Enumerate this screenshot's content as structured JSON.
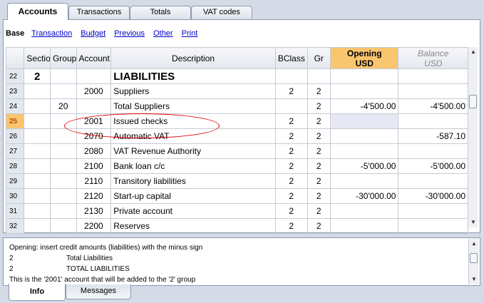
{
  "tabs": [
    "Accounts",
    "Transactions",
    "Totals",
    "VAT codes"
  ],
  "views": {
    "base": "Base",
    "links": [
      "Transaction",
      "Budget",
      "Previous",
      "Other",
      "Print"
    ]
  },
  "columns": {
    "section": "Section",
    "group": "Group",
    "account": "Account",
    "description": "Description",
    "bclass": "BClass",
    "gr": "Gr",
    "opening_line1": "Opening",
    "opening_line2": "USD",
    "balance_line1": "Balance",
    "balance_line2": "USD"
  },
  "rows": [
    {
      "n": "22",
      "section": "2",
      "group": "",
      "account": "",
      "desc": "LIABILITIES",
      "bclass": "",
      "gr": "",
      "opening": "",
      "balance": ""
    },
    {
      "n": "23",
      "section": "",
      "group": "",
      "account": "2000",
      "desc": "Suppliers",
      "bclass": "2",
      "gr": "2",
      "opening": "",
      "balance": ""
    },
    {
      "n": "24",
      "section": "",
      "group": "20",
      "account": "",
      "desc": "Total Suppliers",
      "bclass": "",
      "gr": "2",
      "opening": "-4'500.00",
      "balance": "-4'500.00"
    },
    {
      "n": "25",
      "section": "",
      "group": "",
      "account": "2001",
      "desc": "Issued checks",
      "bclass": "2",
      "gr": "2",
      "opening": "",
      "balance": ""
    },
    {
      "n": "26",
      "section": "",
      "group": "",
      "account": "2070",
      "desc": "Automatic VAT",
      "bclass": "2",
      "gr": "2",
      "opening": "",
      "balance": "-587.10"
    },
    {
      "n": "27",
      "section": "",
      "group": "",
      "account": "2080",
      "desc": "VAT Revenue Authority",
      "bclass": "2",
      "gr": "2",
      "opening": "",
      "balance": ""
    },
    {
      "n": "28",
      "section": "",
      "group": "",
      "account": "2100",
      "desc": "Bank loan c/c",
      "bclass": "2",
      "gr": "2",
      "opening": "-5'000.00",
      "balance": "-5'000.00"
    },
    {
      "n": "29",
      "section": "",
      "group": "",
      "account": "2110",
      "desc": "Transitory liabilities",
      "bclass": "2",
      "gr": "2",
      "opening": "",
      "balance": ""
    },
    {
      "n": "30",
      "section": "",
      "group": "",
      "account": "2120",
      "desc": "Start-up capital",
      "bclass": "2",
      "gr": "2",
      "opening": "-30'000.00",
      "balance": "-30'000.00"
    },
    {
      "n": "31",
      "section": "",
      "group": "",
      "account": "2130",
      "desc": "Private account",
      "bclass": "2",
      "gr": "2",
      "opening": "",
      "balance": ""
    },
    {
      "n": "32",
      "section": "",
      "group": "",
      "account": "2200",
      "desc": "Reserves",
      "bclass": "2",
      "gr": "2",
      "opening": "",
      "balance": ""
    }
  ],
  "info": {
    "line1": "Opening: insert credit amounts (liabilities) with the minus sign",
    "line2a": "2",
    "line2b": "Total Liabilities",
    "line3a": "2",
    "line3b": "TOTAL LIABILITIES",
    "line4": "This is the '2001' account that will be added to the '2' group"
  },
  "bottom_tabs": [
    "Info",
    "Messages"
  ],
  "colors": {
    "selected_header": "#f9c56e",
    "annotation": "#dd0000"
  }
}
